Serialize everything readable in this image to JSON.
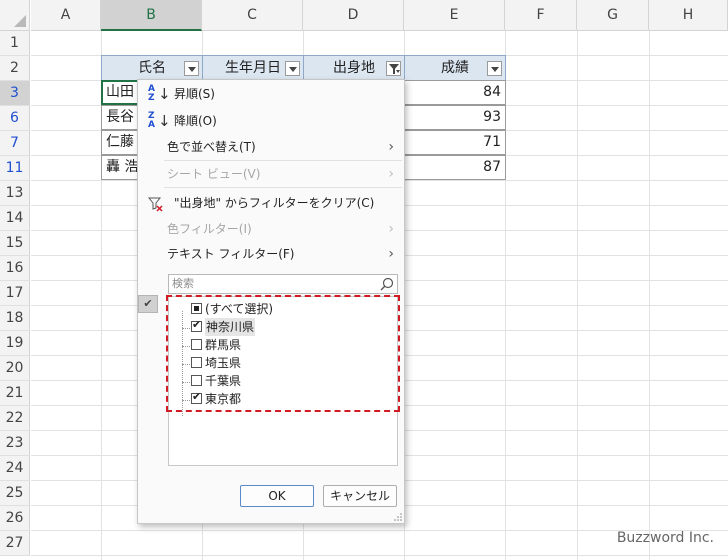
{
  "columns": [
    "A",
    "B",
    "C",
    "D",
    "E",
    "F",
    "G",
    "H"
  ],
  "rows": [
    "1",
    "2",
    "3",
    "6",
    "7",
    "11",
    "13",
    "14",
    "15",
    "16",
    "17",
    "18",
    "19",
    "20",
    "21",
    "22",
    "23",
    "24",
    "25",
    "26",
    "27"
  ],
  "table": {
    "headers": [
      "氏名",
      "生年月日",
      "出身地",
      "成績"
    ],
    "rows": [
      {
        "name": "山田",
        "score": "84"
      },
      {
        "name": "長谷",
        "score": "93"
      },
      {
        "name": "仁藤",
        "score": "71"
      },
      {
        "name": "轟 浩",
        "score": "87"
      }
    ]
  },
  "menu": {
    "sort_asc": "昇順(S)",
    "sort_desc": "降順(O)",
    "sort_by_color": "色で並べ替え(T)",
    "sheet_view": "シート ビュー(V)",
    "clear_filter": "\"出身地\" からフィルターをクリア(C)",
    "color_filter": "色フィルター(I)",
    "text_filter": "テキスト フィルター(F)",
    "search_placeholder": "検索",
    "items": [
      {
        "label": "(すべて選択)",
        "state": "partial"
      },
      {
        "label": "神奈川県",
        "state": "checked"
      },
      {
        "label": "群馬県",
        "state": "unchecked"
      },
      {
        "label": "埼玉県",
        "state": "unchecked"
      },
      {
        "label": "千葉県",
        "state": "unchecked"
      },
      {
        "label": "東京都",
        "state": "checked"
      }
    ],
    "ok": "OK",
    "cancel": "キャンセル"
  },
  "watermark": "Buzzword Inc.",
  "colors": {
    "accent": "#217346",
    "highlight": "#d11b24",
    "filtered_row": "#1f4fd1"
  }
}
